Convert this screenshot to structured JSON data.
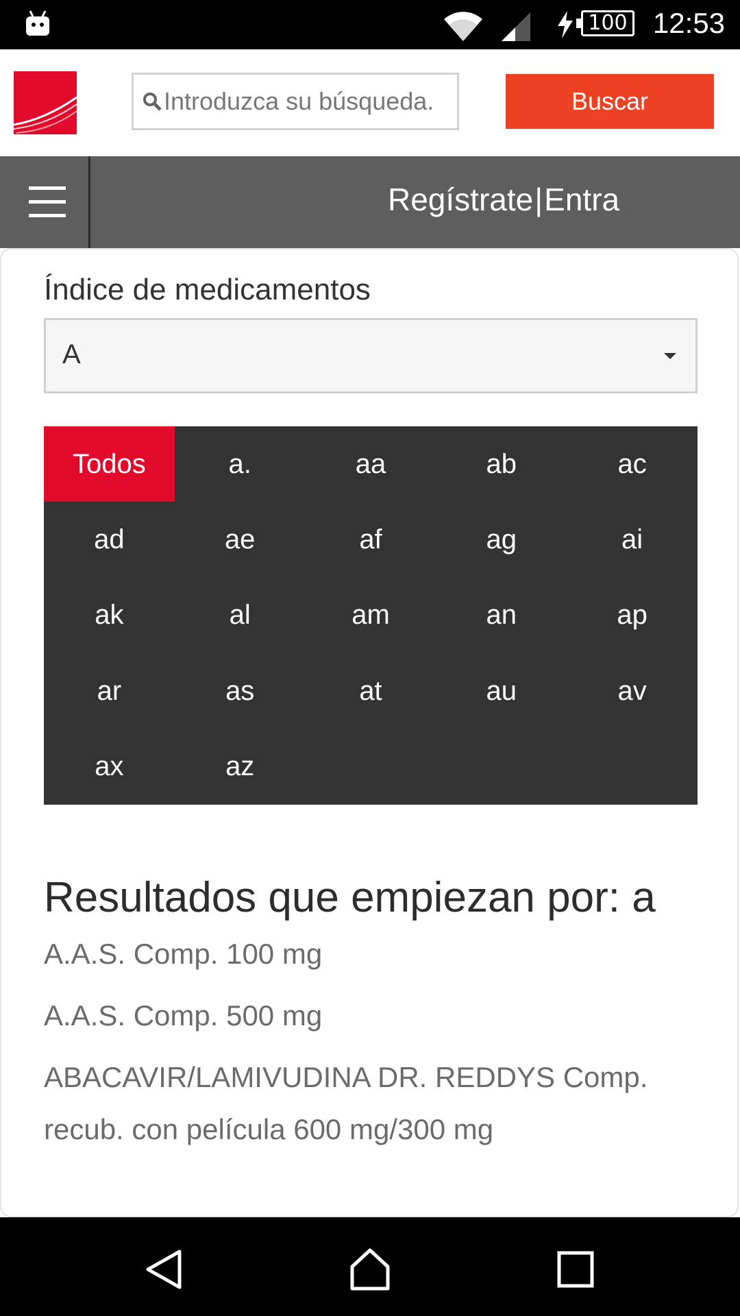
{
  "status_bar": {
    "battery": "100",
    "time": "12:53"
  },
  "header": {
    "search_placeholder": "Introduzca su búsqueda.",
    "search_button": "Buscar"
  },
  "nav": {
    "register": "Regístrate",
    "separator": "|",
    "login": "Entra"
  },
  "index": {
    "title": "Índice de medicamentos",
    "selected_letter": "A",
    "letters": [
      "Todos",
      "a.",
      "aa",
      "ab",
      "ac",
      "ad",
      "ae",
      "af",
      "ag",
      "ai",
      "ak",
      "al",
      "am",
      "an",
      "ap",
      "ar",
      "as",
      "at",
      "au",
      "av",
      "ax",
      "az"
    ],
    "active_letter": "Todos"
  },
  "results": {
    "title": "Resultados que empiezan por: a",
    "items": [
      " A.A.S. Comp. 100 mg",
      " A.A.S. Comp. 500 mg",
      " ABACAVIR/LAMIVUDINA DR. REDDYS Comp. recub. con película 600 mg/300 mg"
    ]
  },
  "colors": {
    "brand_red": "#e20a2b",
    "button_orange": "#ee4023",
    "nav_gray": "#5e5e5e",
    "grid_dark": "#333333"
  }
}
